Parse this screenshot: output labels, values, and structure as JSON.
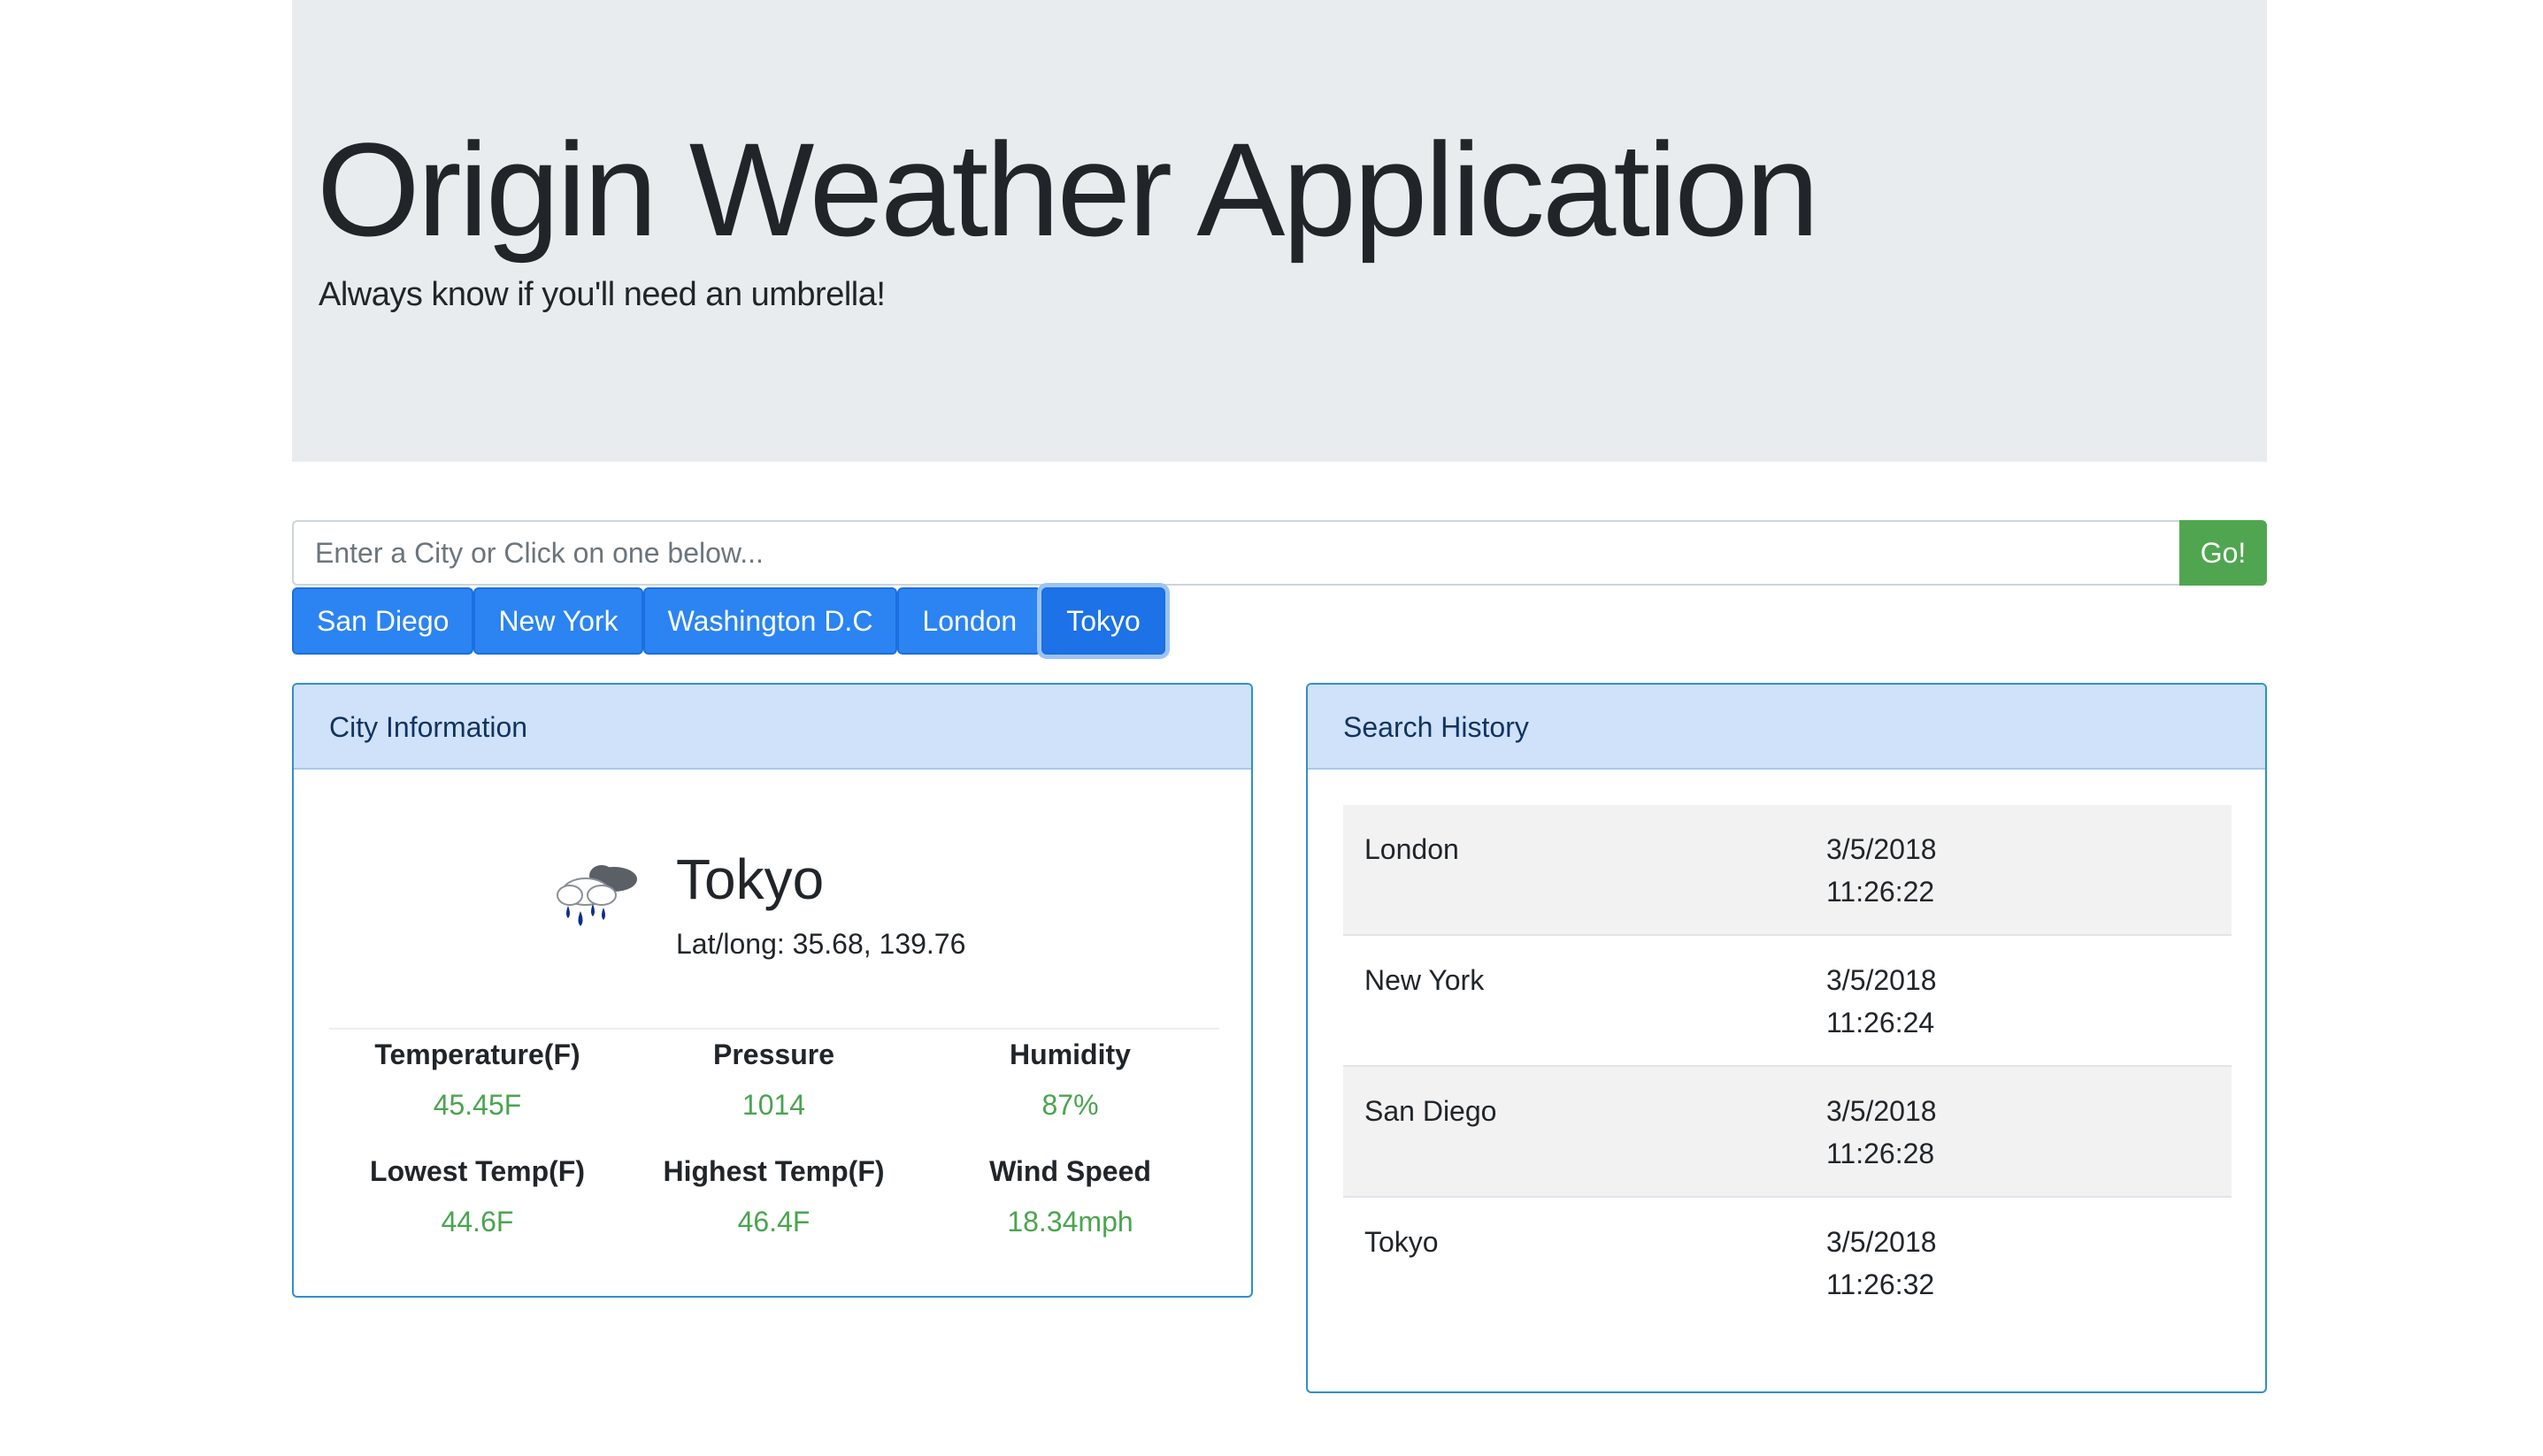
{
  "header": {
    "title": "Origin Weather Application",
    "subtitle": "Always know if you'll need an umbrella!"
  },
  "search": {
    "placeholder": "Enter a City or Click on one below...",
    "value": "",
    "go_label": "Go!"
  },
  "city_buttons": [
    {
      "label": "San Diego"
    },
    {
      "label": "New York"
    },
    {
      "label": "Washington D.C"
    },
    {
      "label": "London"
    },
    {
      "label": "Tokyo",
      "active": true
    }
  ],
  "city_info": {
    "header": "City Information",
    "icon": "rain-cloud-icon",
    "city": "Tokyo",
    "latlong": "Lat/long: 35.68, 139.76",
    "stats": [
      {
        "label": "Temperature(F)",
        "value": "45.45F"
      },
      {
        "label": "Pressure",
        "value": "1014"
      },
      {
        "label": "Humidity",
        "value": "87%"
      },
      {
        "label": "Lowest Temp(F)",
        "value": "44.6F"
      },
      {
        "label": "Highest Temp(F)",
        "value": "46.4F"
      },
      {
        "label": "Wind Speed",
        "value": "18.34mph"
      }
    ]
  },
  "history": {
    "header": "Search History",
    "rows": [
      {
        "city": "London",
        "date": "3/5/2018",
        "time": "11:26:22"
      },
      {
        "city": "New York",
        "date": "3/5/2018",
        "time": "11:26:24"
      },
      {
        "city": "San Diego",
        "date": "3/5/2018",
        "time": "11:26:28"
      },
      {
        "city": "Tokyo",
        "date": "3/5/2018",
        "time": "11:26:32"
      }
    ]
  },
  "colors": {
    "jumbotron_bg": "#e9ecef",
    "primary": "#2b84f1",
    "success": "#50a650",
    "value_green": "#4aa44f",
    "card_border": "#2f8fce",
    "card_header_bg": "#cfe2fa"
  }
}
